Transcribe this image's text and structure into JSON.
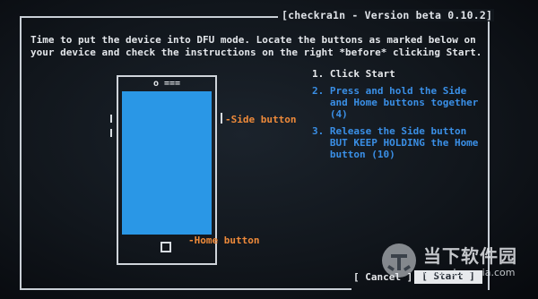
{
  "window": {
    "title": "[checkra1n - Version beta 0.10.2]"
  },
  "intro": {
    "lines": [
      "Time to put the device into DFU mode. Locate the buttons as marked below on",
      "your device and check the instructions on the right *before* clicking Start."
    ]
  },
  "diagram": {
    "top_indicator": "o ===",
    "side_label": "-Side button",
    "home_label": "-Home button",
    "screen_color": "#2a97e6",
    "label_color": "#ee8a3a"
  },
  "steps": [
    {
      "lines": [
        "1. Click Start"
      ],
      "state": "done"
    },
    {
      "lines": [
        "2. Press and hold the Side",
        "   and Home buttons together",
        "   (4)"
      ],
      "state": "active"
    },
    {
      "lines": [
        "3. Release the Side button",
        "   BUT KEEP HOLDING the Home",
        "   button (10)"
      ],
      "state": "active"
    }
  ],
  "buttons": {
    "cancel": "[ Cancel ]",
    "start": "[ Start ]"
  },
  "watermark": {
    "title": "当下软件园",
    "url": "www.downxia.com"
  },
  "colors": {
    "active_step": "#3a8fe6",
    "done_step": "#e8eaed",
    "background": "#11161c"
  }
}
